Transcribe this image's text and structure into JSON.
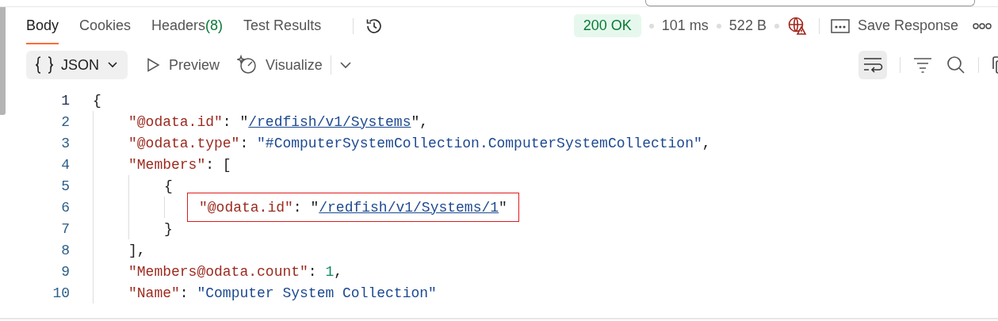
{
  "tabs": [
    {
      "label": "Body",
      "selected": true
    },
    {
      "label": "Cookies",
      "selected": false
    },
    {
      "label": "Headers",
      "count": "(8)",
      "selected": false
    },
    {
      "label": "Test Results",
      "selected": false
    }
  ],
  "status": {
    "code": "200 OK",
    "time": "101 ms",
    "size": "522 B"
  },
  "save_label": "Save Response",
  "format": {
    "label": "JSON"
  },
  "views": [
    "Preview",
    "Visualize"
  ],
  "wrap_on": true,
  "lines": [
    {
      "num": "1",
      "boxed": false,
      "tokens": [
        {
          "kind": "punct",
          "text": "{"
        }
      ],
      "children": [
        {
          "num": "2",
          "boxed": false,
          "tokens": [
            {
              "kind": "key",
              "text": "\"@odata.id\""
            },
            {
              "kind": "punct",
              "text": ": \""
            },
            {
              "kind": "link",
              "text": "/redfish/v1/Systems"
            },
            {
              "kind": "punct",
              "text": "\","
            }
          ]
        },
        {
          "num": "3",
          "boxed": false,
          "tokens": [
            {
              "kind": "key",
              "text": "\"@odata.type\""
            },
            {
              "kind": "punct",
              "text": ": "
            },
            {
              "kind": "string",
              "text": "\"#ComputerSystemCollection.ComputerSystemCollection\""
            },
            {
              "kind": "punct",
              "text": ","
            }
          ]
        },
        {
          "num": "4",
          "boxed": false,
          "tokens": [
            {
              "kind": "key",
              "text": "\"Members\""
            },
            {
              "kind": "punct",
              "text": ": ["
            }
          ],
          "children": [
            {
              "num": "5",
              "boxed": false,
              "tokens": [
                {
                  "kind": "punct",
                  "text": "{"
                }
              ],
              "children": [
                {
                  "num": "6",
                  "boxed": true,
                  "tokens": [
                    {
                      "kind": "key",
                      "text": "\"@odata.id\""
                    },
                    {
                      "kind": "punct",
                      "text": ": \""
                    },
                    {
                      "kind": "link",
                      "text": "/redfish/v1/Systems/1"
                    },
                    {
                      "kind": "punct",
                      "text": "\""
                    }
                  ]
                }
              ]
            },
            {
              "num": "7",
              "boxed": false,
              "tokens": [
                {
                  "kind": "punct",
                  "text": "}"
                }
              ]
            }
          ]
        },
        {
          "num": "8",
          "boxed": false,
          "tokens": [
            {
              "kind": "punct",
              "text": "],"
            }
          ]
        },
        {
          "num": "9",
          "boxed": false,
          "tokens": [
            {
              "kind": "key",
              "text": "\"Members@odata.count\""
            },
            {
              "kind": "punct",
              "text": ": "
            },
            {
              "kind": "number",
              "text": "1"
            },
            {
              "kind": "punct",
              "text": ","
            }
          ]
        },
        {
          "num": "10",
          "boxed": false,
          "tokens": [
            {
              "kind": "key",
              "text": "\"Name\""
            },
            {
              "kind": "punct",
              "text": ": "
            },
            {
              "kind": "string",
              "text": "\"Computer System Collection\""
            }
          ]
        }
      ]
    }
  ]
}
